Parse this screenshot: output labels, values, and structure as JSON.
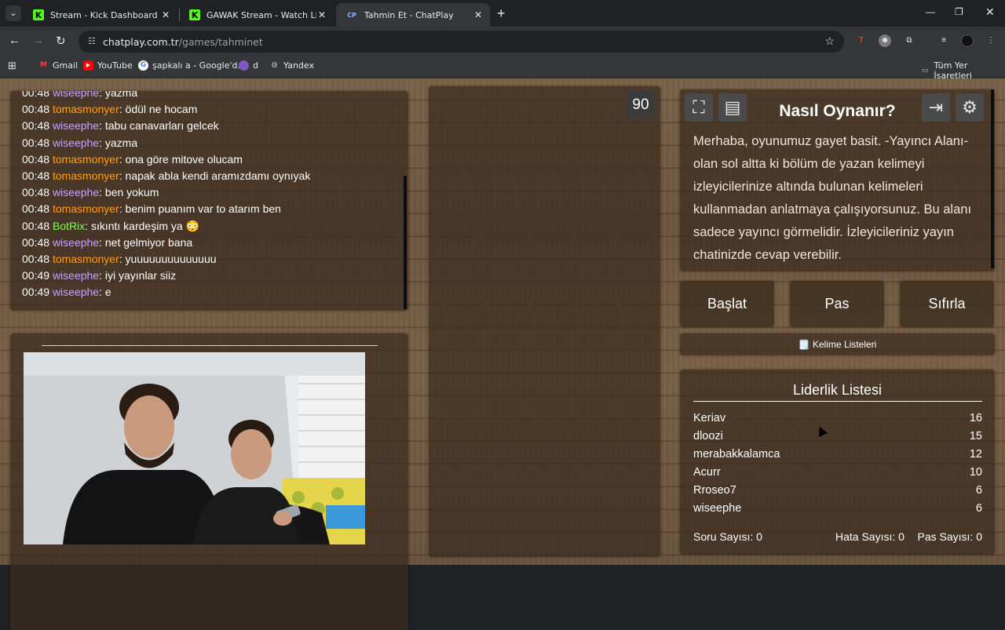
{
  "browser": {
    "tabs": [
      {
        "title": "Stream - Kick Dashboard",
        "icon": "kick-icon",
        "active": false
      },
      {
        "title": "GAWAK Stream - Watch Live on",
        "icon": "kick-icon",
        "active": false
      },
      {
        "title": "Tahmin Et - ChatPlay",
        "icon": "chatplay-icon",
        "active": true
      }
    ],
    "favicon_cp": "CP",
    "favicon_kick": "K",
    "url_domain": "chatplay.com.tr",
    "url_path": "/games/tahminet",
    "bookmarks": [
      "Gmail",
      "YouTube",
      "şapkalı a - Google'd...",
      "d",
      "Yandex"
    ],
    "all_bookmarks": "Tüm Yer İşaretleri"
  },
  "chat": {
    "messages": [
      {
        "time": "00:48",
        "user": "wiseephe",
        "text": ": yazma",
        "color": "#c9a0ff"
      },
      {
        "time": "00:48",
        "user": "tomasmonyer",
        "text": ": ödül ne hocam",
        "color": "#ff9f1a"
      },
      {
        "time": "00:48",
        "user": "wiseephe",
        "text": ": tabu canavarları gelcek",
        "color": "#c9a0ff"
      },
      {
        "time": "00:48",
        "user": "wiseephe",
        "text": ": yazma",
        "color": "#c9a0ff"
      },
      {
        "time": "00:48",
        "user": "tomasmonyer",
        "text": ": ona göre mitove olucam",
        "color": "#ff9f1a"
      },
      {
        "time": "00:48",
        "user": "tomasmonyer",
        "text": ": napak abla kendi aramızdamı oynıyak",
        "color": "#ff9f1a"
      },
      {
        "time": "00:48",
        "user": "wiseephe",
        "text": ": ben yokum",
        "color": "#c9a0ff"
      },
      {
        "time": "00:48",
        "user": "tomasmonyer",
        "text": ": benim puanım var to atarım ben",
        "color": "#ff9f1a"
      },
      {
        "time": "00:48",
        "user": "BotRix",
        "text": ": sıkıntı kardeşim ya 😳",
        "color": "#7dff4f"
      },
      {
        "time": "00:48",
        "user": "wiseephe",
        "text": ": net gelmiyor bana",
        "color": "#c9a0ff"
      },
      {
        "time": "00:48",
        "user": "tomasmonyer",
        "text": ": yuuuuuuuuuuuuuu",
        "color": "#ff9f1a"
      },
      {
        "time": "00:49",
        "user": "wiseephe",
        "text": ": iyi yayınlar siiz",
        "color": "#c9a0ff"
      },
      {
        "time": "00:49",
        "user": "wiseephe",
        "text": ": e",
        "color": "#c9a0ff"
      }
    ]
  },
  "timer": "90",
  "howto": {
    "title": "Nasıl Oynanır?",
    "text": "Merhaba, oyunumuz gayet basit. -Yayıncı Alanı- olan sol altta ki bölüm de yazan kelimeyi izleyicilerinize altında bulunan kelimeleri kullanmadan anlatmaya çalışıyorsunuz. Bu alanı sadece yayıncı görmelidir. İzleyicileriniz yayın chatinizde cevap verebilir."
  },
  "controls": {
    "start": "Başlat",
    "pass": "Pas",
    "reset": "Sıfırla",
    "word_lists": "Kelime Listeleri"
  },
  "leaderboard": {
    "title": "Liderlik Listesi",
    "rows": [
      {
        "name": "Keriav",
        "score": "16"
      },
      {
        "name": "dloozi",
        "score": "15"
      },
      {
        "name": "merabakkalamca",
        "score": "12"
      },
      {
        "name": "Acurr",
        "score": "10"
      },
      {
        "name": "Rroseo7",
        "score": "6"
      },
      {
        "name": "wiseephe",
        "score": "6"
      }
    ],
    "questions": "Soru Sayısı: 0",
    "errors": "Hata Sayısı: 0",
    "passes": "Pas Sayısı: 0"
  }
}
